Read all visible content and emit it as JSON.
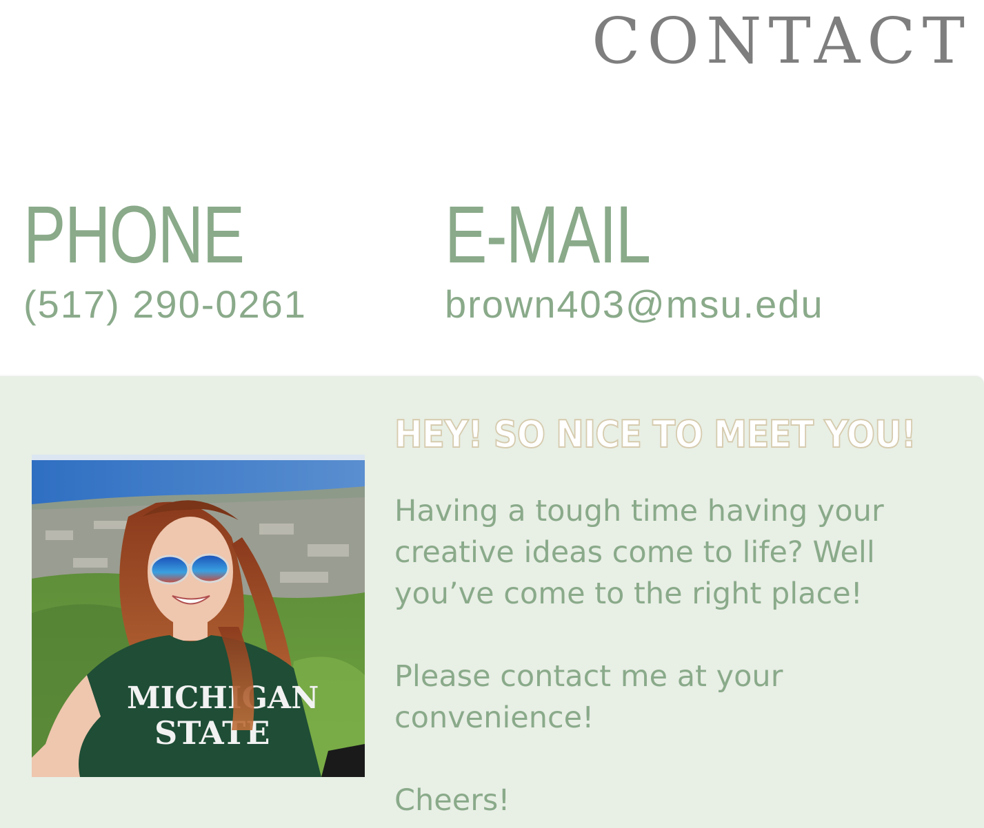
{
  "page": {
    "title": "CONTACT"
  },
  "phone": {
    "heading": "PHONE",
    "value": "(517) 290-0261"
  },
  "email": {
    "heading": "E-MAIL",
    "value": "brown403@msu.edu"
  },
  "about": {
    "greeting": "HEY! SO NICE TO MEET YOU!",
    "paragraphs": [
      "Having a tough time having your creative ideas come to life? Well you’ve come to the right place!",
      "Please contact me at your convenience!",
      "Cheers!"
    ],
    "photo_shirt_text_line1": "MICHIGAN",
    "photo_shirt_text_line2": "STATE"
  },
  "colors": {
    "accent_green": "#8aaa8a",
    "heading_gray": "#7e7e7e",
    "panel_background": "#e8efe5",
    "greeting_outline": "#d6cbae"
  }
}
